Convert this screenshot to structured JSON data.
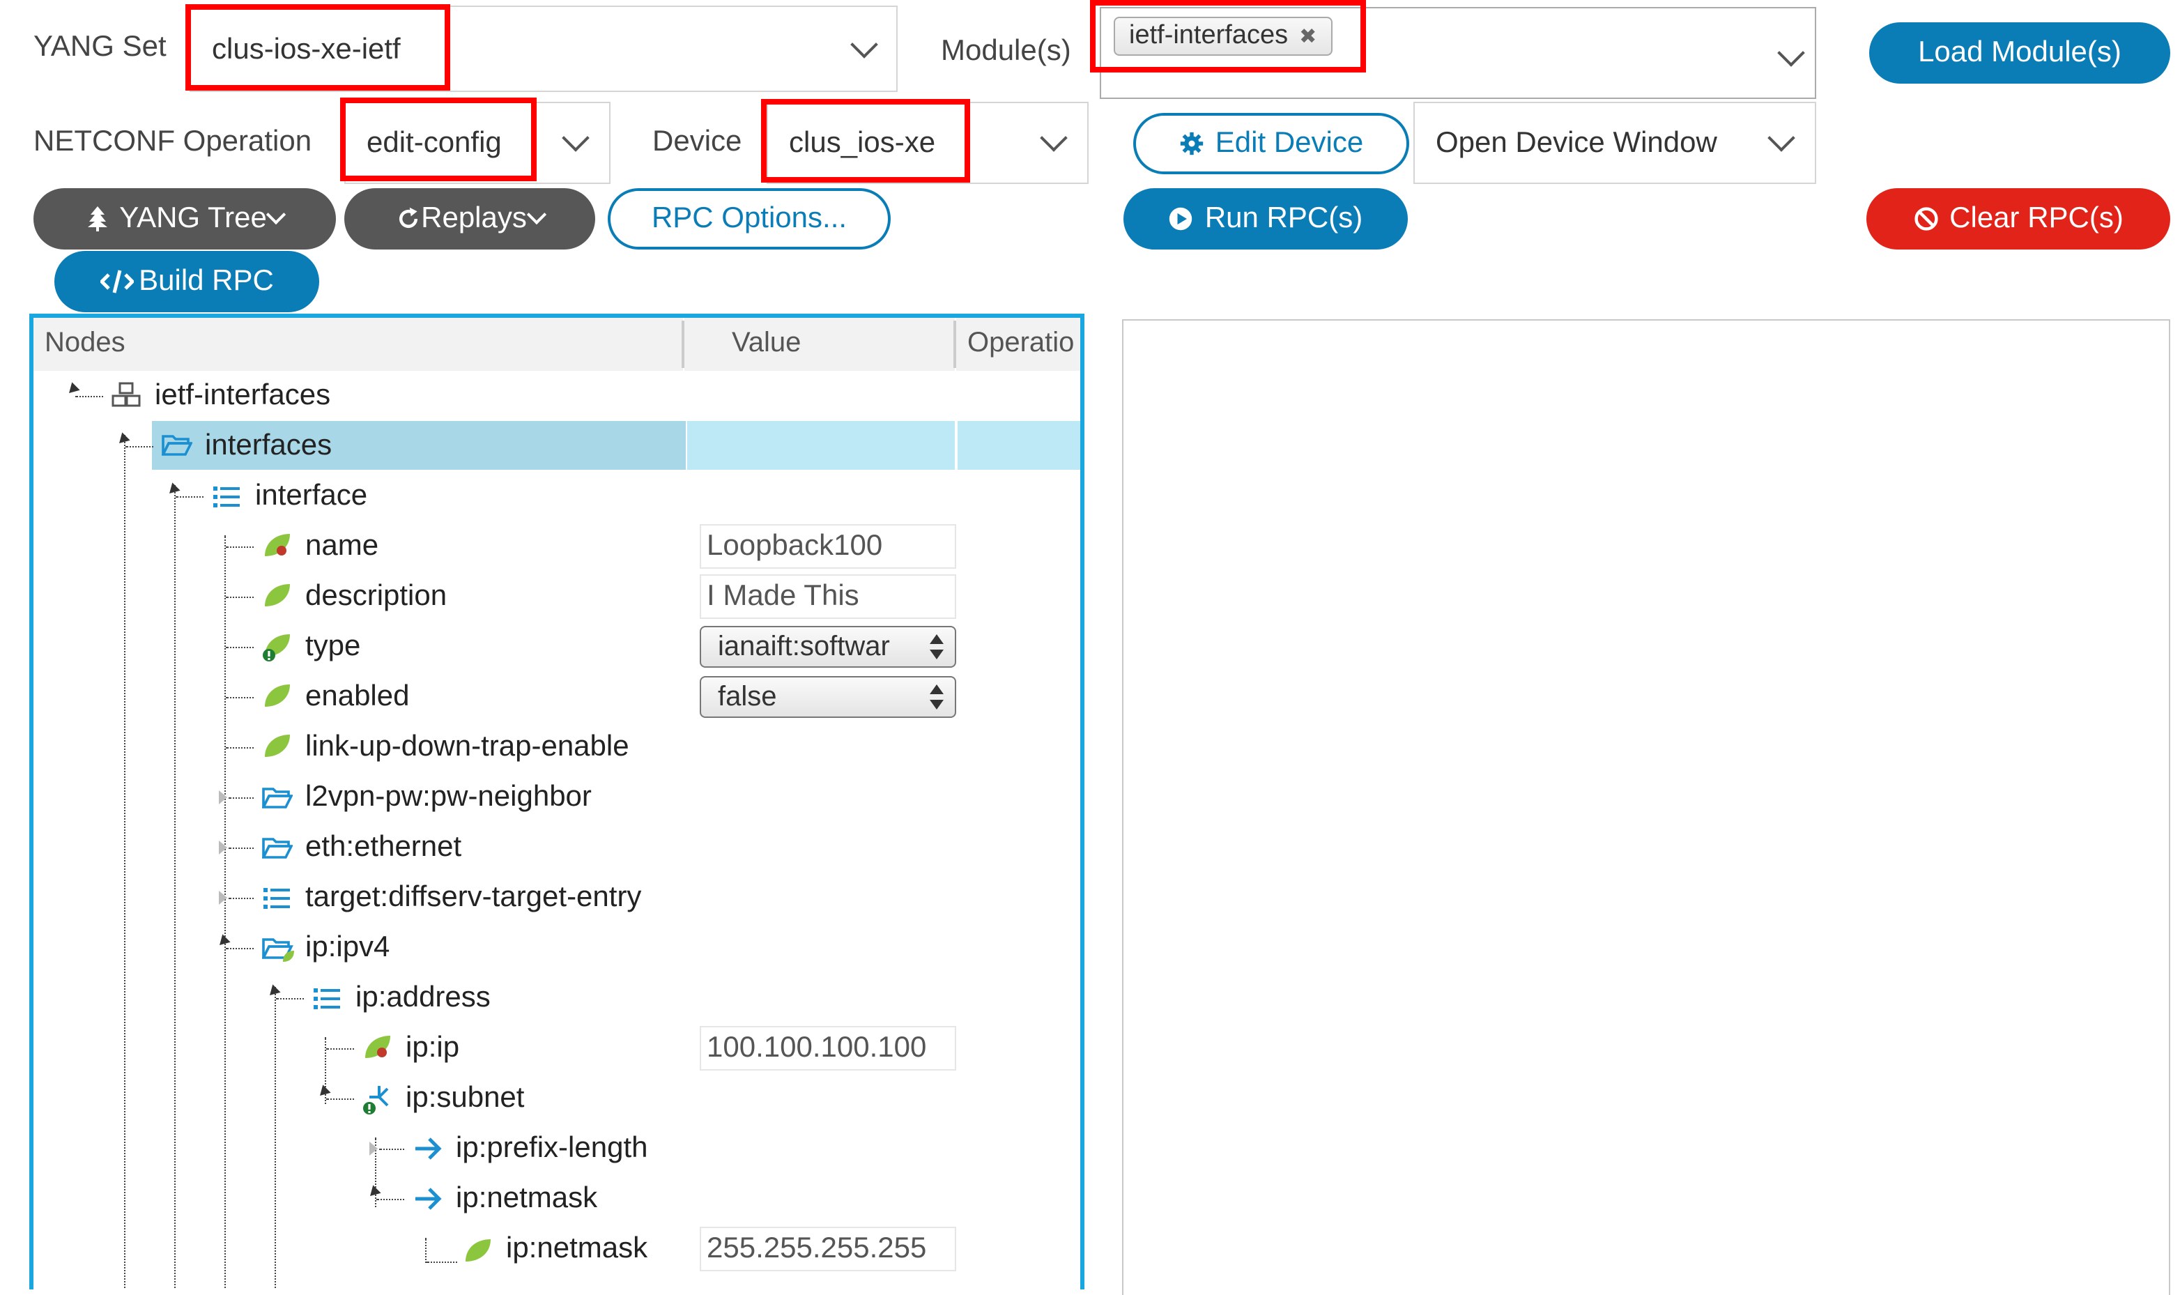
{
  "toolbar": {
    "yang_set_label": "YANG Set",
    "yang_set_value": "clus-ios-xe-ietf",
    "modules_label": "Module(s)",
    "module_tag": "ietf-interfaces",
    "module_tag_remove": "✖",
    "load_modules": "Load Module(s)",
    "netconf_op_label": "NETCONF Operation",
    "netconf_op_value": "edit-config",
    "device_label": "Device",
    "device_value": "clus_ios-xe",
    "edit_device": "Edit Device",
    "open_device_window": "Open Device Window",
    "yang_tree": "YANG Tree",
    "replays": "Replays",
    "rpc_options": "RPC Options...",
    "run_rpc": "Run RPC(s)",
    "clear_rpc": "Clear RPC(s)",
    "build_rpc": "Build RPC"
  },
  "tree": {
    "headers": {
      "nodes": "Nodes",
      "value": "Value",
      "operation": "Operatio"
    },
    "nodes": {
      "ietf_interfaces": "ietf-interfaces",
      "interfaces": "interfaces",
      "interface": "interface",
      "name": "name",
      "description": "description",
      "type": "type",
      "enabled": "enabled",
      "link_up_down": "link-up-down-trap-enable",
      "pw_neighbor": "l2vpn-pw:pw-neighbor",
      "ethernet": "eth:ethernet",
      "diffserv": "target:diffserv-target-entry",
      "ipv4": "ip:ipv4",
      "address": "ip:address",
      "ip": "ip:ip",
      "subnet": "ip:subnet",
      "prefix_length": "ip:prefix-length",
      "netmask_choice": "ip:netmask",
      "netmask_leaf": "ip:netmask"
    },
    "values": {
      "name": "Loopback100",
      "description": "I Made This",
      "type": "ianaift:softwar",
      "enabled": "false",
      "ip": "100.100.100.100",
      "netmask": "255.255.255.255"
    }
  },
  "colors": {
    "accent_blue": "#0a7db7",
    "danger_red": "#e2231a",
    "highlight_red": "#ff0000",
    "panel_border": "#1aa7e0",
    "selected_row": "#a8d8e8"
  }
}
